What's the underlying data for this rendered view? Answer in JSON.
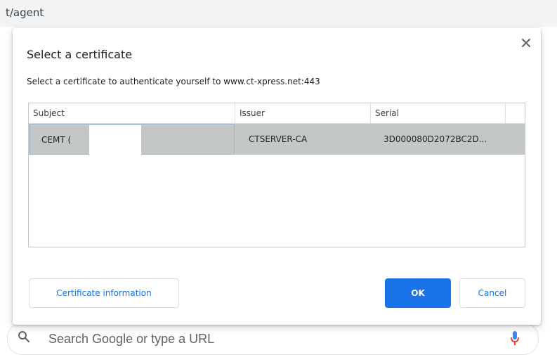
{
  "browser": {
    "address_text": "t/agent",
    "search_placeholder": "Search Google or type a URL"
  },
  "dialog": {
    "title": "Select a certificate",
    "subtitle": "Select a certificate to authenticate yourself to www.ct-xpress.net:443",
    "columns": [
      "Subject",
      "Issuer",
      "Serial"
    ],
    "rows": [
      {
        "subject": "CEMT (",
        "issuer": "CTSERVER-CA",
        "serial": "3D000080D2072BC2D..."
      }
    ],
    "buttons": {
      "certificate_info": "Certificate information",
      "ok": "OK",
      "cancel": "Cancel"
    }
  },
  "icons": {
    "close": "close-icon",
    "search": "search-icon",
    "mic": "mic-icon"
  },
  "colors": {
    "accent": "#1a73e8",
    "selected_row": "#c3c7c7",
    "mic_red": "#ea4335"
  }
}
